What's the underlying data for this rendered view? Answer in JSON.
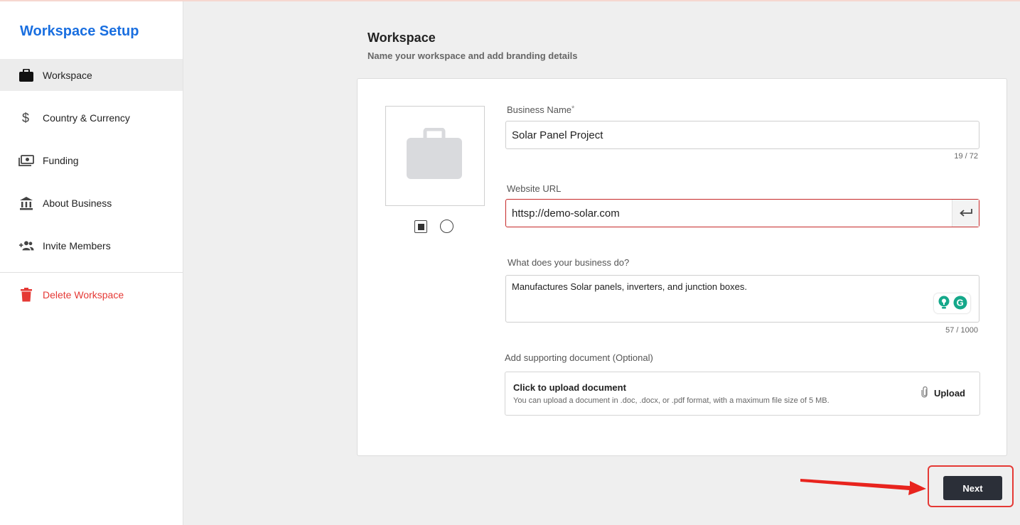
{
  "sidebar": {
    "title": "Workspace Setup",
    "items": [
      {
        "label": "Workspace",
        "icon": "briefcase-icon",
        "active": true
      },
      {
        "label": "Country & Currency",
        "icon": "dollar-icon",
        "active": false
      },
      {
        "label": "Funding",
        "icon": "money-icon",
        "active": false
      },
      {
        "label": "About Business",
        "icon": "bank-icon",
        "active": false
      },
      {
        "label": "Invite Members",
        "icon": "group-add-icon",
        "active": false
      }
    ],
    "delete": {
      "label": "Delete Workspace",
      "icon": "trash-icon"
    }
  },
  "header": {
    "title": "Workspace",
    "subtitle": "Name your workspace and add branding details"
  },
  "form": {
    "logo": {
      "icon": "briefcase-placeholder-icon",
      "shape_options": [
        "square",
        "circle"
      ],
      "selected_shape": "square"
    },
    "business_name": {
      "label": "Business Name",
      "required_marker": "*",
      "value": "Solar Panel Project",
      "counter": "19 / 72"
    },
    "website": {
      "label": "Website URL",
      "value": "httsp://demo-solar.com",
      "state": "error",
      "action_icon": "enter-icon"
    },
    "description": {
      "label": "What does your business do?",
      "value": "Manufactures Solar panels, inverters, and junction boxes.",
      "counter": "57 / 1000"
    },
    "document": {
      "label": "Add supporting document (Optional)",
      "title": "Click to upload document",
      "hint": "You can upload a document in .doc, .docx, or .pdf format, with a maximum file size of 5 MB.",
      "upload_label": "Upload",
      "upload_icon": "paperclip-icon"
    }
  },
  "footer": {
    "next_label": "Next"
  },
  "colors": {
    "accent": "#1a6fe0",
    "danger": "#e53935",
    "primary_button": "#2b2f38",
    "background": "#efefef"
  }
}
